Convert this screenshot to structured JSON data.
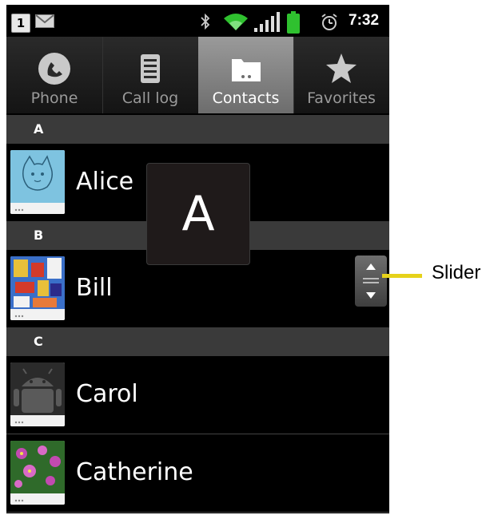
{
  "status_bar": {
    "notification_badge": "1",
    "icons": [
      "envelope-icon",
      "bluetooth-icon",
      "wifi-icon",
      "signal-icon",
      "battery-icon",
      "alarm-icon"
    ],
    "time": "7:32"
  },
  "tabs": [
    {
      "label": "Phone",
      "icon": "phone-icon",
      "selected": false
    },
    {
      "label": "Call log",
      "icon": "call-log-icon",
      "selected": false
    },
    {
      "label": "Contacts",
      "icon": "contacts-folder-icon",
      "selected": true
    },
    {
      "label": "Favorites",
      "icon": "star-icon",
      "selected": false
    }
  ],
  "sections": [
    {
      "letter": "A",
      "contacts": [
        {
          "name": "Alice",
          "photo": "cat-sketch"
        }
      ]
    },
    {
      "letter": "B",
      "contacts": [
        {
          "name": "Bill",
          "photo": "colorful-painting"
        }
      ]
    },
    {
      "letter": "C",
      "contacts": [
        {
          "name": "Carol",
          "photo": "android-robot"
        },
        {
          "name": "Catherine",
          "photo": "flowers"
        }
      ]
    }
  ],
  "fast_scroll_letter": "A",
  "callout": {
    "label": "Slider"
  },
  "colors": {
    "callout_line": "#e6d21a",
    "selected_tab": "#8a8a8a",
    "section_header": "#3a3a3a"
  }
}
